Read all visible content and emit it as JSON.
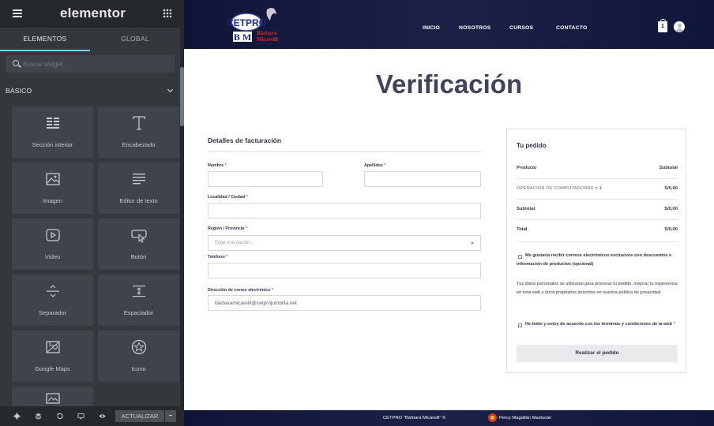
{
  "panel": {
    "logo": "elementor",
    "tabs": [
      {
        "label": "ELEMENTOS",
        "active": true
      },
      {
        "label": "GLOBAL",
        "active": false
      }
    ],
    "search_placeholder": "Buscar widget...",
    "category": "BÁSICO",
    "widgets": [
      {
        "label": "Sección interior",
        "icon": "inner-section-icon"
      },
      {
        "label": "Encabezado",
        "icon": "heading-icon"
      },
      {
        "label": "Imagen",
        "icon": "image-icon"
      },
      {
        "label": "Editor de texto",
        "icon": "text-editor-icon"
      },
      {
        "label": "Vídeo",
        "icon": "video-icon"
      },
      {
        "label": "Botón",
        "icon": "button-icon"
      },
      {
        "label": "Separador",
        "icon": "divider-icon"
      },
      {
        "label": "Espaciador",
        "icon": "spacer-icon"
      },
      {
        "label": "Google Maps",
        "icon": "google-maps-icon"
      },
      {
        "label": "Icono",
        "icon": "star-icon"
      },
      {
        "label": "",
        "icon": "image-box-icon"
      }
    ],
    "footer": {
      "update_label": "ACTUALIZAR"
    }
  },
  "site": {
    "logo_text": "CETPRO Bárbara Micarelli",
    "nav": [
      "INICIO",
      "NOSOTROS",
      "CURSOS",
      "CONTACTO"
    ],
    "cart_count": "1",
    "page_title": "Verificación",
    "billing": {
      "title": "Detalles de facturación",
      "fields": {
        "nombre": {
          "label": "Nombre",
          "value": ""
        },
        "apellidos": {
          "label": "Apellidos",
          "value": ""
        },
        "localidad": {
          "label": "Localidad / Ciudad",
          "value": ""
        },
        "region": {
          "label": "Región / Provincia",
          "placeholder": "Elige una opción..."
        },
        "telefono": {
          "label": "Teléfono",
          "value": ""
        },
        "email": {
          "label": "Dirección de correo electrónico",
          "value": "barbaramicarelli@cetprojumbilla.net"
        }
      },
      "required_mark": "*"
    },
    "order": {
      "title": "Tu pedido",
      "col_product": "Producto",
      "col_subtotal": "Subtotal",
      "item_name": "OPERACIÓN DE COMPUTADORAS",
      "item_qty": "× 1",
      "item_price": "S/0,00",
      "subtotal_label": "Subtotal",
      "subtotal_value": "S/0,00",
      "total_label": "Total",
      "total_value": "S/0,00",
      "newsletter_text": "Me gustaría recibir correos electrónicos exclusivos con descuentos e información de productos (opcional)",
      "privacy_text": "Tus datos personales se utilizarán para procesar tu pedido, mejorar tu experiencia en esta web y otros propósitos descritos en nuestra política de privacidad.",
      "terms_text": "He leído y estoy de acuerdo con los términos y condiciones de la web",
      "place_order": "Realizar el pedido"
    },
    "footer_left": "CETPRO \"Bárbara Micarelli\" ©",
    "footer_right": "Percy Magallán Maslucán"
  }
}
